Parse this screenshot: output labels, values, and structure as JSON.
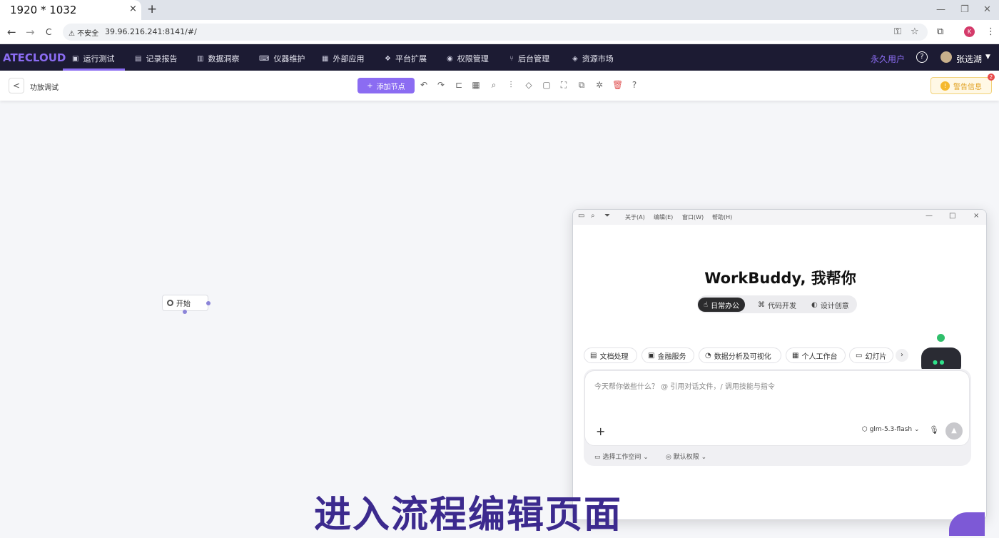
{
  "browser": {
    "tab_title": "1920 * 1032",
    "tab_close": "×",
    "new_tab": "+",
    "nav": {
      "back": "←",
      "forward": "→",
      "reload": "C"
    },
    "security_label": "不安全",
    "url": "39.96.216.241:8141/#/",
    "window_controls": [
      "—",
      "❐",
      "✕"
    ],
    "profile_initial": "K"
  },
  "app": {
    "logo": "ATECLOUD",
    "menu": [
      {
        "label": "运行测试",
        "icon": "chart-icon",
        "active": true
      },
      {
        "label": "记录报告",
        "icon": "clipboard-icon"
      },
      {
        "label": "数据洞察",
        "icon": "bar-chart-icon"
      },
      {
        "label": "仪器维护",
        "icon": "keyboard-icon"
      },
      {
        "label": "外部应用",
        "icon": "grid-icon"
      },
      {
        "label": "平台扩展",
        "icon": "cubes-icon"
      },
      {
        "label": "权限管理",
        "icon": "robot-icon"
      },
      {
        "label": "后台管理",
        "icon": "branch-icon"
      },
      {
        "label": "资源市场",
        "icon": "tag-icon"
      }
    ],
    "vip_label": "永久用户",
    "help": "?",
    "user_name": "张选湖"
  },
  "toolbar": {
    "page_name": "功放调试",
    "add_node_label": "添加节点",
    "alert_label": "警告信息",
    "alert_count": "2"
  },
  "canvas": {
    "start_node_label": "开始"
  },
  "workbuddy": {
    "menus": [
      "关于(A)",
      "编辑(E)",
      "窗口(W)",
      "帮助(H)"
    ],
    "title": "WorkBuddy, 我帮你",
    "modes": [
      {
        "label": "日常办公",
        "active": true
      },
      {
        "label": "代码开发"
      },
      {
        "label": "设计创意"
      }
    ],
    "chips": [
      "文档处理",
      "金融服务",
      "数据分析及可视化",
      "个人工作台",
      "幻灯片"
    ],
    "input_placeholder": "今天帮你做些什么？ @ 引用对话文件，/ 调用技能与指令",
    "model": "glm-5.3-flash",
    "workspace_label": "选择工作空间",
    "permission_label": "默认权限"
  },
  "caption": "进入流程编辑页面",
  "colors": {
    "accent": "#8b6cf2",
    "nav_bg": "#1c1b33",
    "caption": "#3c2a8e"
  }
}
